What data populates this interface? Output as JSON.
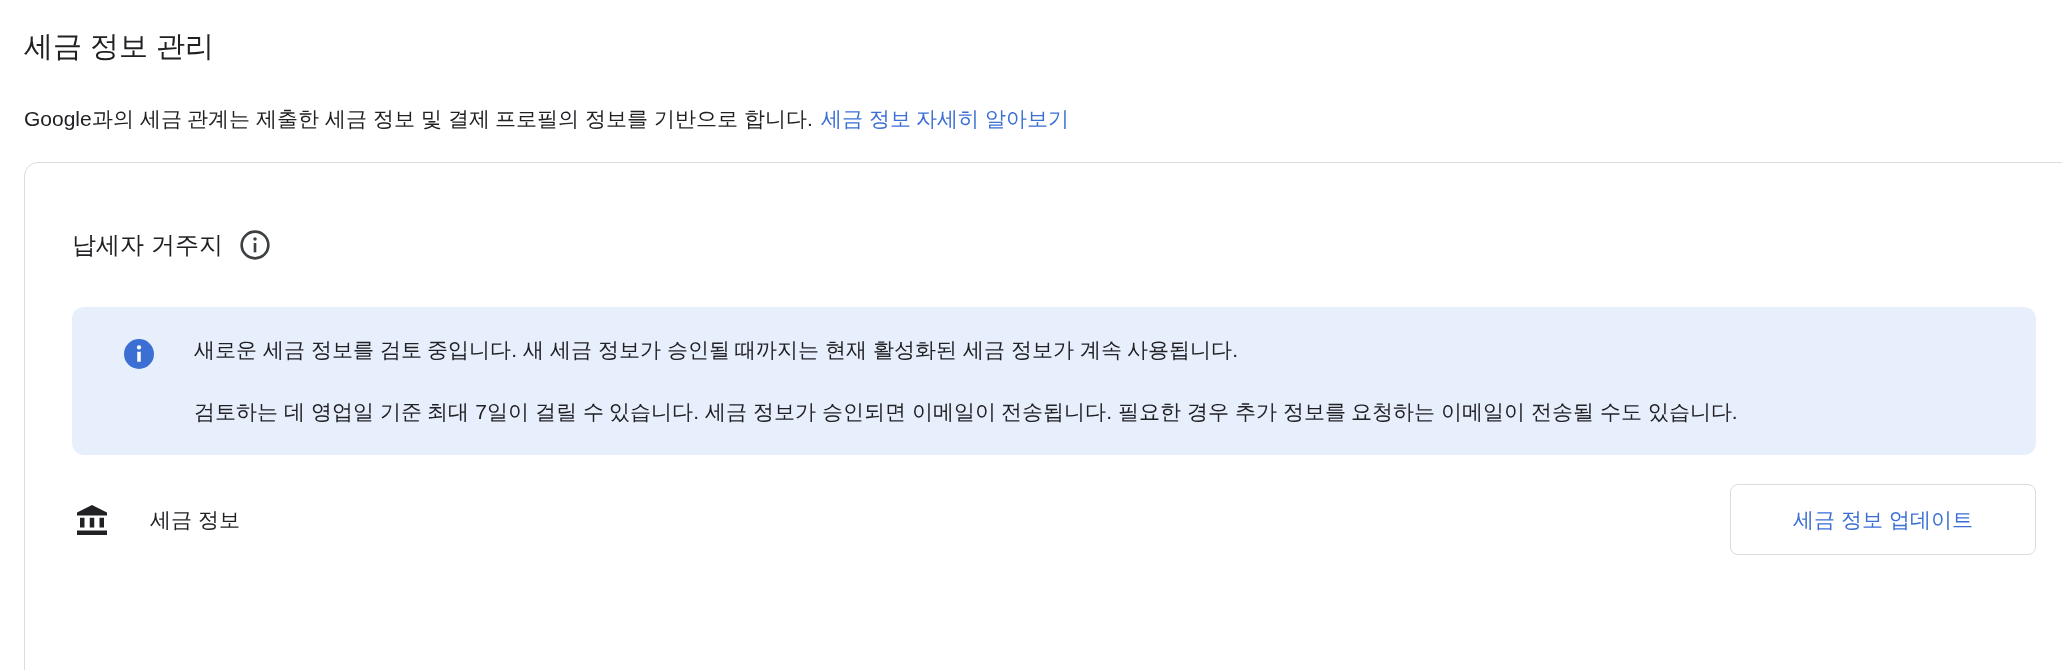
{
  "page": {
    "title": "세금 정보 관리",
    "description": "Google과의 세금 관계는 제출한 세금 정보 및 결제 프로필의 정보를 기반으로 합니다.",
    "link": "세금 정보 자세히 알아보기"
  },
  "card": {
    "heading": "납세자 거주지",
    "notice": [
      "새로운 세금 정보를 검토 중입니다. 새 세금 정보가 승인될 때까지는 현재 활성화된 세금 정보가 계속 사용됩니다.",
      "검토하는 데 영업일 기준 최대 7일이 걸릴 수 있습니다. 세금 정보가 승인되면 이메일이 전송됩니다. 필요한 경우 추가 정보를 요청하는 이메일이 전송될 수도 있습니다."
    ],
    "tax_info": {
      "label": "세금 정보",
      "button": "세금 정보 업데이트"
    }
  }
}
